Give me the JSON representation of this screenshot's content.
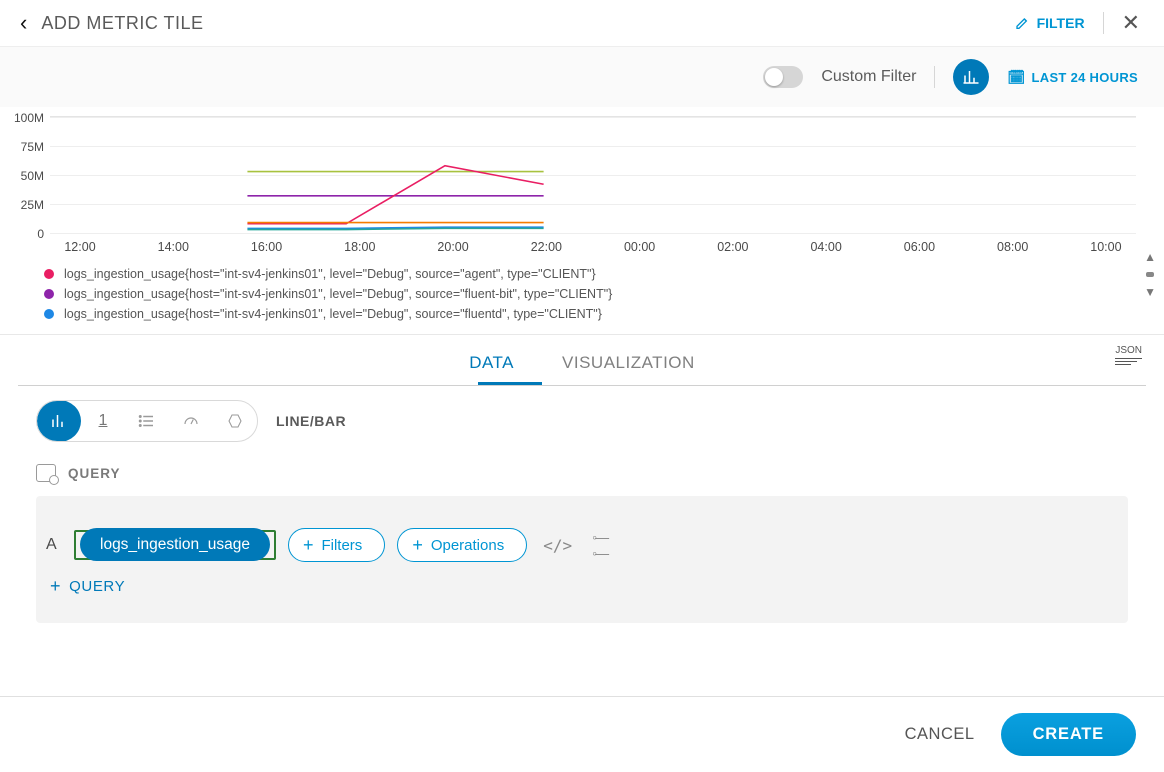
{
  "header": {
    "title": "ADD METRIC TILE",
    "filter": "FILTER"
  },
  "subbar": {
    "custom_filter": "Custom Filter",
    "time_range": "LAST 24 HOURS"
  },
  "tabs": {
    "data": "DATA",
    "visualization": "VISUALIZATION",
    "json": "JSON"
  },
  "chart_types": {
    "label": "LINE/BAR",
    "num_icon": "1"
  },
  "query": {
    "section": "QUERY",
    "letter": "A",
    "metric": "logs_ingestion_usage",
    "filters_btn": "Filters",
    "operations_btn": "Operations",
    "add_query": "QUERY"
  },
  "footer": {
    "cancel": "CANCEL",
    "create": "CREATE"
  },
  "chart_data": {
    "type": "line",
    "ylabel": "",
    "ylim": [
      0,
      100
    ],
    "xlim_hours": [
      "12:00",
      "10:00_next"
    ],
    "y_ticks": [
      "0",
      "25M",
      "50M",
      "75M",
      "100M"
    ],
    "x_ticks": [
      "12:00",
      "14:00",
      "16:00",
      "18:00",
      "20:00",
      "22:00",
      "00:00",
      "02:00",
      "04:00",
      "06:00",
      "08:00",
      "10:00"
    ],
    "legend": [
      {
        "color": "#e91e63",
        "label": "logs_ingestion_usage{host=\"int-sv4-jenkins01\", level=\"Debug\", source=\"agent\", type=\"CLIENT\"}"
      },
      {
        "color": "#8e24aa",
        "label": "logs_ingestion_usage{host=\"int-sv4-jenkins01\", level=\"Debug\", source=\"fluent-bit\", type=\"CLIENT\"}"
      },
      {
        "color": "#1e88e5",
        "label": "logs_ingestion_usage{host=\"int-sv4-jenkins01\", level=\"Debug\", source=\"fluentd\", type=\"CLIENT\"}"
      }
    ],
    "series": [
      {
        "name": "green_flat",
        "color": "#a8c23f",
        "x": [
          "16:00",
          "18:00",
          "20:00",
          "22:00"
        ],
        "y": [
          53,
          53,
          53,
          53
        ]
      },
      {
        "name": "purple_flat",
        "color": "#8e24aa",
        "x": [
          "16:00",
          "18:00",
          "20:00",
          "22:00"
        ],
        "y": [
          32,
          32,
          32,
          32
        ]
      },
      {
        "name": "pink_peak",
        "color": "#e91e63",
        "x": [
          "16:00",
          "18:00",
          "20:00",
          "22:00"
        ],
        "y": [
          8,
          8,
          58,
          42
        ]
      },
      {
        "name": "orange_flat",
        "color": "#f57c00",
        "x": [
          "16:00",
          "18:00",
          "20:00",
          "22:00"
        ],
        "y": [
          9,
          9,
          9,
          9
        ]
      },
      {
        "name": "blue_low",
        "color": "#1e88e5",
        "x": [
          "16:00",
          "18:00",
          "20:00",
          "22:00"
        ],
        "y": [
          4,
          4,
          5,
          5
        ]
      },
      {
        "name": "teal_low",
        "color": "#26a69a",
        "x": [
          "16:00",
          "18:00",
          "20:00",
          "22:00"
        ],
        "y": [
          3,
          3,
          4,
          4
        ]
      }
    ]
  }
}
